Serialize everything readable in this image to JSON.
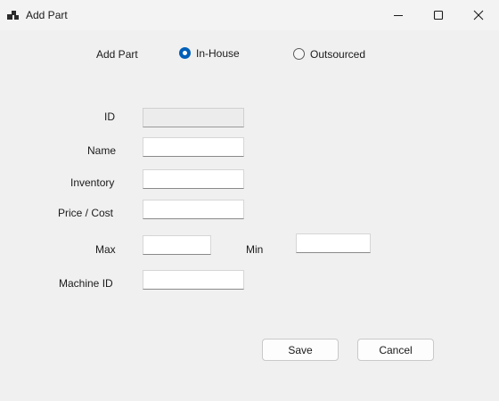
{
  "window": {
    "title": "Add Part",
    "icon": "app-icon",
    "controls": {
      "minimize_icon": "minimize-icon",
      "maximize_icon": "maximize-icon",
      "close_icon": "close-icon"
    }
  },
  "form": {
    "heading": "Add Part",
    "source_type": {
      "options": [
        {
          "label": "In-House",
          "checked": true
        },
        {
          "label": "Outsourced",
          "checked": false
        }
      ]
    },
    "fields": {
      "id": {
        "label": "ID",
        "value": "",
        "enabled": false
      },
      "name": {
        "label": "Name",
        "value": ""
      },
      "inventory": {
        "label": "Inventory",
        "value": ""
      },
      "price_cost": {
        "label": "Price / Cost",
        "value": ""
      },
      "max": {
        "label": "Max",
        "value": ""
      },
      "min": {
        "label": "Min",
        "value": ""
      },
      "machine_id": {
        "label": "Machine ID",
        "value": ""
      }
    },
    "buttons": {
      "save": "Save",
      "cancel": "Cancel"
    }
  },
  "colors": {
    "accent": "#005fb8",
    "window_bg": "#f0f0f0",
    "titlebar_bg": "#f3f3f3"
  }
}
